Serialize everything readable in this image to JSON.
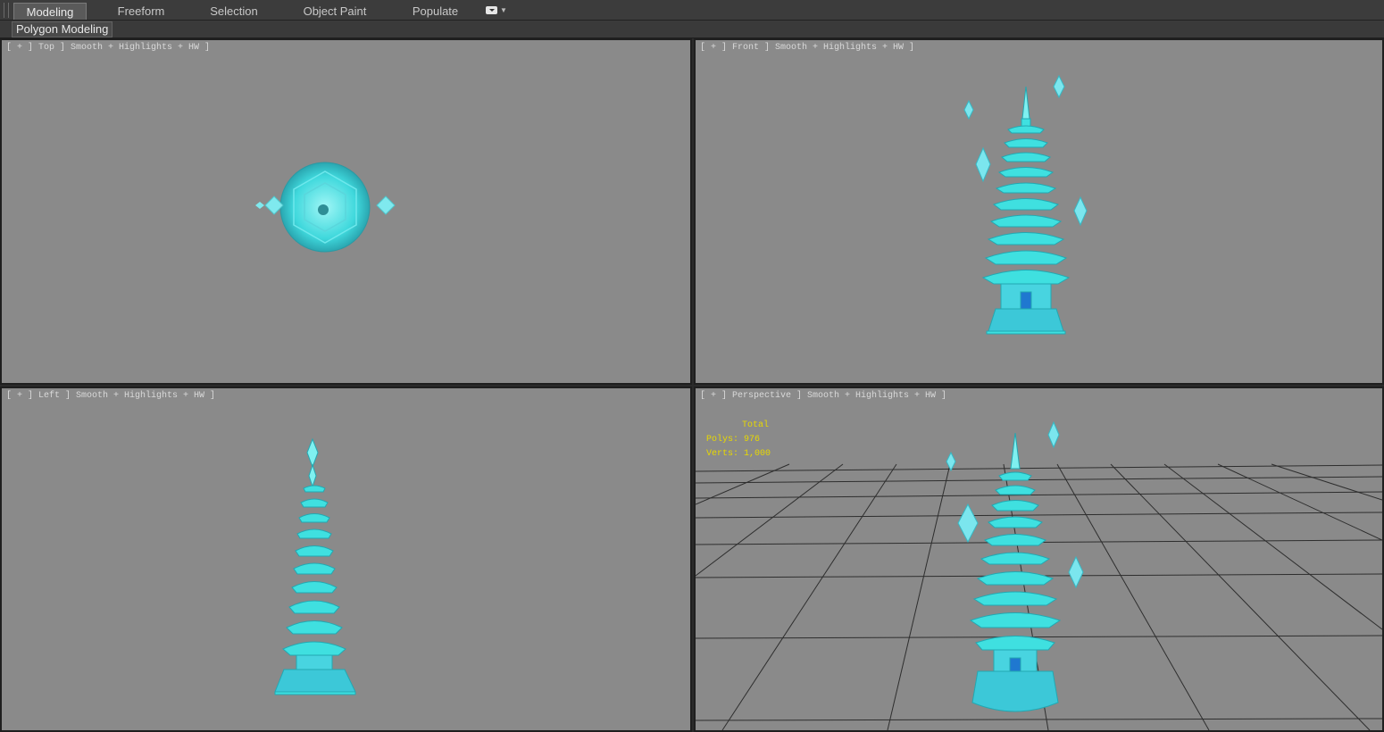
{
  "ribbon": {
    "tabs": [
      {
        "label": "Modeling",
        "active": true
      },
      {
        "label": "Freeform",
        "active": false
      },
      {
        "label": "Selection",
        "active": false
      },
      {
        "label": "Object Paint",
        "active": false
      },
      {
        "label": "Populate",
        "active": false
      }
    ],
    "menu_icon": "ribbon-options-icon"
  },
  "subbar": {
    "panel_label": "Polygon Modeling"
  },
  "viewports": {
    "top": {
      "label": "[ + ] Top ] Smooth + Highlights + HW ]"
    },
    "front": {
      "label": "[ + ] Front ] Smooth + Highlights + HW ]"
    },
    "left": {
      "label": "[ + ] Left ] Smooth + Highlights + HW ]"
    },
    "perspective": {
      "label": "[ + ] Perspective ] Smooth + Highlights + HW ]"
    }
  },
  "stats": {
    "title": "Total",
    "polys": "Polys: 976",
    "verts": "Verts: 1,000"
  },
  "colors": {
    "viewport_bg": "#8a8a8a",
    "model_cyan": "#3fe0e0",
    "stats_yellow": "#e8d800"
  }
}
